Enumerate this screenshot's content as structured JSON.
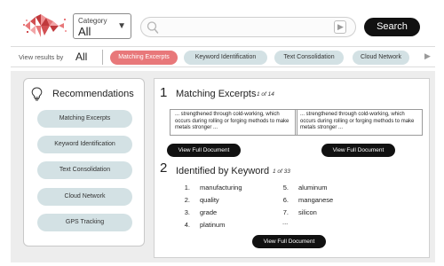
{
  "header": {
    "logo_icon": "diamond-mosaic-logo",
    "category": {
      "label": "Category",
      "value": "All"
    },
    "search": {
      "placeholder": "",
      "value": ""
    },
    "search_button": "Search"
  },
  "filters": {
    "label": "View results by",
    "value": "All",
    "chips": [
      {
        "label": "Matching Excerpts",
        "active": true
      },
      {
        "label": "Keyword Identification",
        "active": false
      },
      {
        "label": "Text Consolidation",
        "active": false
      },
      {
        "label": "Cloud Network",
        "active": false
      }
    ]
  },
  "recommendations": {
    "title": "Recommendations",
    "icon": "lightbulb-icon",
    "items": [
      "Matching Excerpts",
      "Keyword Identification",
      "Text Consolidation",
      "Cloud Network",
      "GPS Tracking"
    ]
  },
  "sections": {
    "excerpts": {
      "number": "1",
      "title": "Matching Excerpts",
      "count": "1 of 14",
      "items": [
        "... strengthened through cold-working, which occurs during rolling or forging methods to make metals stronger ...",
        "... strengthened through cold-working, which occurs during rolling or forging methods to make metals stronger ..."
      ],
      "button": "View Full Document"
    },
    "keywords": {
      "number": "2",
      "title": "Identified by Keyword",
      "count": "1 of 33",
      "items": [
        {
          "n": "1.",
          "word": "manufacturing"
        },
        {
          "n": "2.",
          "word": "quality"
        },
        {
          "n": "3.",
          "word": "grade"
        },
        {
          "n": "4.",
          "word": "platinum"
        },
        {
          "n": "5.",
          "word": "aluminum"
        },
        {
          "n": "6.",
          "word": "manganese"
        },
        {
          "n": "7.",
          "word": "silicon"
        }
      ],
      "more": "...",
      "button": "View Full Document"
    }
  },
  "colors": {
    "accent": "#e8787a",
    "chip": "#d3e1e4",
    "dark_button": "#111111",
    "content_bg": "#ededed"
  }
}
